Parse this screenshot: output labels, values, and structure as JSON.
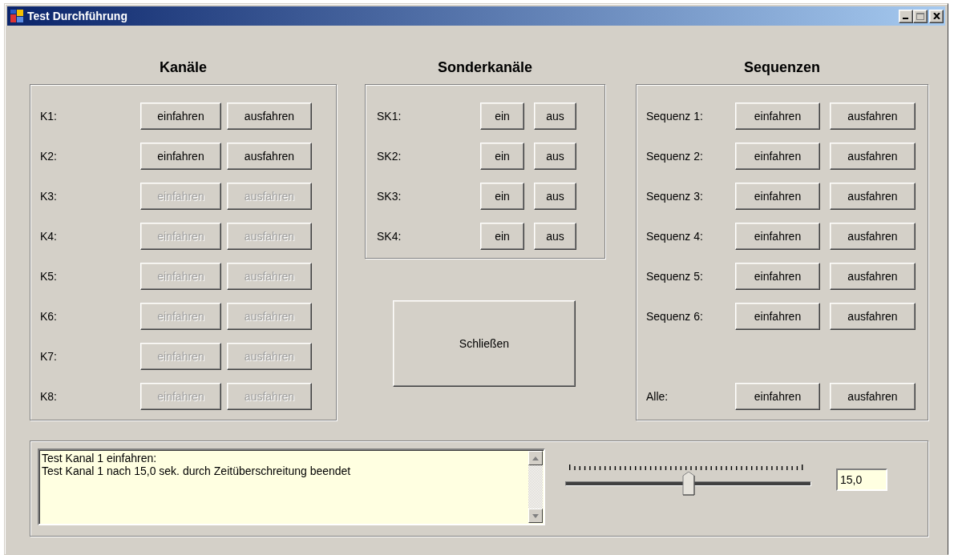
{
  "window": {
    "title": "Test Durchführung"
  },
  "channels": {
    "heading": "Kanäle",
    "rows": [
      {
        "label": "K1:",
        "buttons": [
          {
            "label": "einfahren",
            "disabled": false
          },
          {
            "label": "ausfahren",
            "disabled": false
          }
        ]
      },
      {
        "label": "K2:",
        "buttons": [
          {
            "label": "einfahren",
            "disabled": false
          },
          {
            "label": "ausfahren",
            "disabled": false
          }
        ]
      },
      {
        "label": "K3:",
        "buttons": [
          {
            "label": "einfahren",
            "disabled": true
          },
          {
            "label": "ausfahren",
            "disabled": true
          }
        ]
      },
      {
        "label": "K4:",
        "buttons": [
          {
            "label": "einfahren",
            "disabled": true
          },
          {
            "label": "ausfahren",
            "disabled": true
          }
        ]
      },
      {
        "label": "K5:",
        "buttons": [
          {
            "label": "einfahren",
            "disabled": true
          },
          {
            "label": "ausfahren",
            "disabled": true
          }
        ]
      },
      {
        "label": "K6:",
        "buttons": [
          {
            "label": "einfahren",
            "disabled": true
          },
          {
            "label": "ausfahren",
            "disabled": true
          }
        ]
      },
      {
        "label": "K7:",
        "buttons": [
          {
            "label": "einfahren",
            "disabled": true
          },
          {
            "label": "ausfahren",
            "disabled": true
          }
        ]
      },
      {
        "label": "K8:",
        "buttons": [
          {
            "label": "einfahren",
            "disabled": true
          },
          {
            "label": "ausfahren",
            "disabled": true
          }
        ]
      }
    ]
  },
  "special_channels": {
    "heading": "Sonderkanäle",
    "rows": [
      {
        "label": "SK1:",
        "buttons": [
          {
            "label": "ein",
            "disabled": false
          },
          {
            "label": "aus",
            "disabled": false
          }
        ]
      },
      {
        "label": "SK2:",
        "buttons": [
          {
            "label": "ein",
            "disabled": false
          },
          {
            "label": "aus",
            "disabled": false
          }
        ]
      },
      {
        "label": "SK3:",
        "buttons": [
          {
            "label": "ein",
            "disabled": false
          },
          {
            "label": "aus",
            "disabled": false
          }
        ]
      },
      {
        "label": "SK4:",
        "buttons": [
          {
            "label": "ein",
            "disabled": false
          },
          {
            "label": "aus",
            "disabled": false
          }
        ]
      }
    ]
  },
  "close_button": "Schließen",
  "sequences": {
    "heading": "Sequenzen",
    "rows": [
      {
        "label": "Sequenz 1:",
        "buttons": [
          {
            "label": "einfahren",
            "disabled": false
          },
          {
            "label": "ausfahren",
            "disabled": false
          }
        ]
      },
      {
        "label": "Sequenz 2:",
        "buttons": [
          {
            "label": "einfahren",
            "disabled": false
          },
          {
            "label": "ausfahren",
            "disabled": false
          }
        ]
      },
      {
        "label": "Sequenz 3:",
        "buttons": [
          {
            "label": "einfahren",
            "disabled": false
          },
          {
            "label": "ausfahren",
            "disabled": false
          }
        ]
      },
      {
        "label": "Sequenz 4:",
        "buttons": [
          {
            "label": "einfahren",
            "disabled": false
          },
          {
            "label": "ausfahren",
            "disabled": false
          }
        ]
      },
      {
        "label": "Sequenz 5:",
        "buttons": [
          {
            "label": "einfahren",
            "disabled": false
          },
          {
            "label": "ausfahren",
            "disabled": false
          }
        ]
      },
      {
        "label": "Sequenz 6:",
        "buttons": [
          {
            "label": "einfahren",
            "disabled": false
          },
          {
            "label": "ausfahren",
            "disabled": false
          }
        ]
      }
    ],
    "all_row": {
      "label": "Alle:",
      "buttons": [
        {
          "label": "einfahren",
          "disabled": false
        },
        {
          "label": "ausfahren",
          "disabled": false
        }
      ]
    }
  },
  "log": {
    "lines": [
      "Test Kanal 1 einfahren:",
      "Test Kanal 1 nach 15,0 sek. durch Zeitüberschreitung beendet"
    ]
  },
  "timeout": {
    "level": 0.5,
    "value": "15,0"
  }
}
